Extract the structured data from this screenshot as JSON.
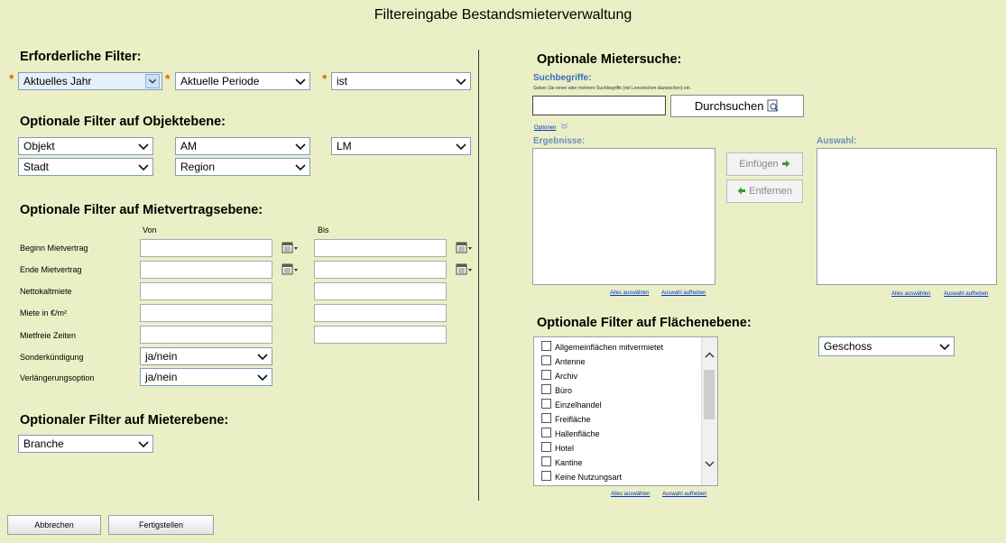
{
  "title": "Filtereingabe Bestandsmieterverwaltung",
  "required": {
    "heading": "Erforderliche Filter:",
    "year": "Aktuelles Jahr",
    "period": "Aktuelle Periode",
    "status": "ist"
  },
  "object_filters": {
    "heading": "Optionale Filter auf Objektebene:",
    "objekt": "Objekt",
    "am": "AM",
    "lm": "LM",
    "stadt": "Stadt",
    "region": "Region"
  },
  "contract_filters": {
    "heading": "Optionale Filter auf Mietvertragsebene:",
    "col_from": "Von",
    "col_to": "Bis",
    "rows": {
      "beginn": "Beginn Mietvertrag",
      "ende": "Ende Mietvertrag",
      "netto": "Nettokaltmiete",
      "miete": "Miete in €/m²",
      "mietfrei": "Mietfreie Zeiten",
      "sonder": "Sonderkündigung",
      "verl": "Verlängerungsoption"
    },
    "sonder_value": "ja/nein",
    "verl_value": "ja/nein"
  },
  "tenant_filter": {
    "heading": "Optionaler Filter auf Mieterebene:",
    "branche": "Branche"
  },
  "tenant_search": {
    "heading": "Optionale Mietersuche:",
    "label": "Suchbegriffe:",
    "hint": "Geben Sie einen oder mehrere Suchbegriffe (mit Leerzeichen dazwischen) ein.",
    "search_button": "Durchsuchen",
    "options": "Optionen",
    "results_label": "Ergebnisse:",
    "selection_label": "Auswahl:",
    "insert_button": "Einfügen",
    "remove_button": "Entfernen",
    "select_all": "Alles auswählen",
    "deselect": "Auswahl aufheben"
  },
  "area_filters": {
    "heading": "Optionale Filter auf Flächenebene:",
    "items": [
      "Allgemeinflächen mitvermietet",
      "Antenne",
      "Archiv",
      "Büro",
      "Einzelhandel",
      "Freifläche",
      "Hallenfläche",
      "Hotel",
      "Kantine",
      "Keine Nutzungsart"
    ],
    "geschoss": "Geschoss",
    "select_all": "Alles auswählen",
    "deselect": "Auswahl aufheben"
  },
  "footer": {
    "cancel": "Abbrechen",
    "finish": "Fertigstellen"
  }
}
